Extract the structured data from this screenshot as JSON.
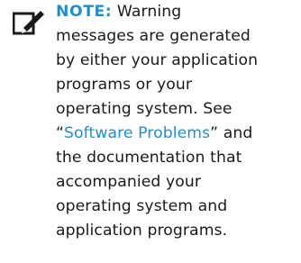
{
  "note": {
    "icon": "pencil-note-icon",
    "label": "NOTE:",
    "first_line_text": " Warning",
    "lines": [
      "messages are generated",
      "by either your application",
      "programs or your",
      "operating system. See"
    ],
    "quote_open": "“",
    "link_text": "Software Problems",
    "quote_close_and_text": "” and",
    "closing_lines": [
      "the documentation that",
      "accompanied your",
      "operating system and",
      "application programs."
    ]
  },
  "colors": {
    "accent": "#1f8fcc",
    "text": "#1a1a1a"
  }
}
